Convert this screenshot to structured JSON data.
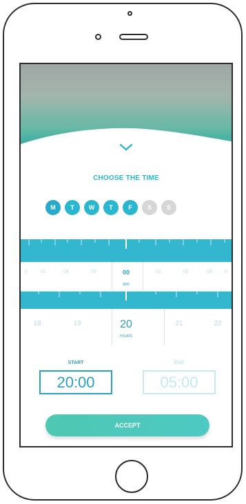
{
  "title": "CHOOSE THE TIME",
  "days": [
    {
      "label": "M",
      "selected": true
    },
    {
      "label": "T",
      "selected": true
    },
    {
      "label": "W",
      "selected": true
    },
    {
      "label": "T",
      "selected": true
    },
    {
      "label": "F",
      "selected": true
    },
    {
      "label": "S",
      "selected": false
    },
    {
      "label": "S",
      "selected": false
    }
  ],
  "minute_picker": {
    "ticks": [
      "0",
      "01",
      "04",
      "09",
      "01",
      "02",
      "08",
      "0"
    ],
    "selected": "00",
    "unit": "MIN"
  },
  "hour_picker": {
    "ticks": [
      "18",
      "19",
      "21",
      "22"
    ],
    "selected": "20",
    "unit": "HOURS"
  },
  "start": {
    "label": "START",
    "value": "20:00"
  },
  "end": {
    "label": "END",
    "value": "05:00"
  },
  "accept_label": "ACCEPT",
  "icons": {
    "expand": "chevron-down-icon"
  },
  "colors": {
    "accent": "#2bb6cf",
    "accent_dark": "#2c9fc0",
    "button": "#4ec8b2",
    "disabled": "#d6d6d6"
  }
}
